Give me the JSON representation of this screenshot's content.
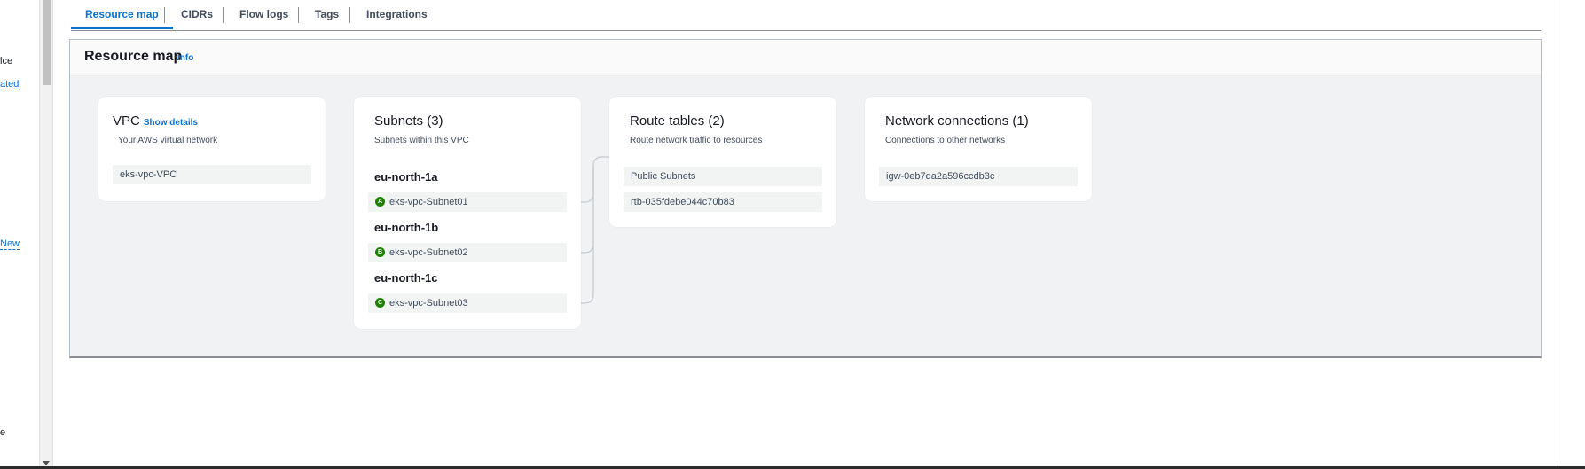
{
  "sidebar_fragments": [
    "lce",
    "ated",
    "New",
    "e"
  ],
  "tabs": [
    {
      "label": "Resource map",
      "active": true
    },
    {
      "label": "CIDRs",
      "active": false
    },
    {
      "label": "Flow logs",
      "active": false
    },
    {
      "label": "Tags",
      "active": false
    },
    {
      "label": "Integrations",
      "active": false
    }
  ],
  "resource_map": {
    "title": "Resource map",
    "info_label": "Info",
    "vpc": {
      "title": "VPC",
      "show_details": "Show details",
      "description": "Your AWS virtual network",
      "name": "eks-vpc-VPC"
    },
    "subnets": {
      "title": "Subnets (3)",
      "description": "Subnets within this VPC",
      "zones": [
        {
          "zone": "eu-north-1a",
          "badge": "A",
          "subnet": "eks-vpc-Subnet01"
        },
        {
          "zone": "eu-north-1b",
          "badge": "B",
          "subnet": "eks-vpc-Subnet02"
        },
        {
          "zone": "eu-north-1c",
          "badge": "C",
          "subnet": "eks-vpc-Subnet03"
        }
      ]
    },
    "route_tables": {
      "title": "Route tables (2)",
      "description": "Route network traffic to resources",
      "items": [
        "Public Subnets",
        "rtb-035fdebe044c70b83"
      ]
    },
    "network_connections": {
      "title": "Network connections (1)",
      "description": "Connections to other networks",
      "items": [
        "igw-0eb7da2a596ccdb3c"
      ]
    }
  },
  "colors": {
    "accent": "#0972d3",
    "az_badge": "#1d8102",
    "panel_background": "#f1f2f3"
  }
}
